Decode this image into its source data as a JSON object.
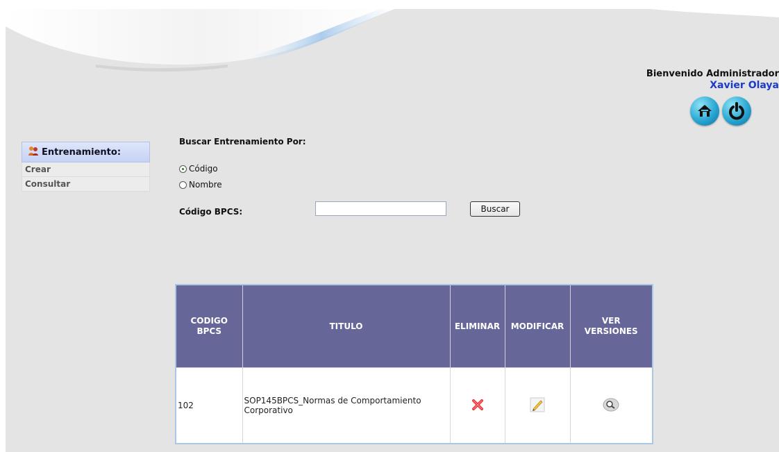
{
  "header": {
    "welcome_text": "Bienvenido Administrador",
    "user_name": "Xavier Olaya",
    "home_icon": "home-icon",
    "logout_icon": "power-icon"
  },
  "sidebar": {
    "section_title": "Entrenamiento:",
    "section_icon": "users-icon",
    "items": [
      {
        "label": "Crear"
      },
      {
        "label": "Consultar"
      }
    ]
  },
  "search": {
    "heading": "Buscar Entrenamiento Por:",
    "options": [
      {
        "label": "Código",
        "selected": true
      },
      {
        "label": "Nombre",
        "selected": false
      }
    ],
    "field_label": "Código BPCS:",
    "field_value": "",
    "button_label": "Buscar"
  },
  "table": {
    "columns": [
      "CODIGO BPCS",
      "TITULO",
      "ELIMINAR",
      "MODIFICAR",
      "VER VERSIONES"
    ],
    "rows": [
      {
        "codigo": "102",
        "titulo": "SOP145BPCS_Normas de Comportamiento Corporativo",
        "eliminar_icon": "delete-x-icon",
        "modificar_icon": "edit-pencil-icon",
        "versiones_icon": "view-magnifier-icon"
      }
    ]
  },
  "colors": {
    "table_header": "#666699",
    "user_name": "#1a3cc8",
    "sidebar_header": "#c6d2f5"
  }
}
